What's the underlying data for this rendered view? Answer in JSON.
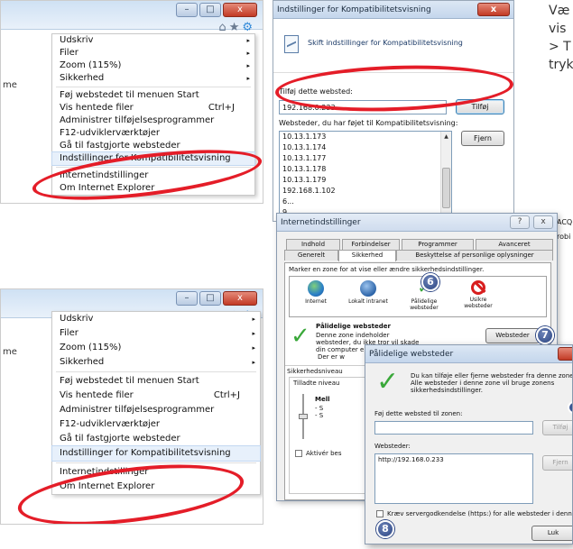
{
  "edge_text": {
    "line1": "Væ",
    "line2": "vis",
    "line3": "> T",
    "line4": "tryk"
  },
  "ie_menu_top": {
    "page_fragment": "me",
    "window_buttons": {
      "minimize": "–",
      "maximize": "□",
      "close": "x"
    },
    "icons": {
      "home": "⌂",
      "favorites": "★",
      "tools": "⚙"
    },
    "items": [
      {
        "label": "Udskriv",
        "arrow": "▸"
      },
      {
        "label": "Filer",
        "arrow": "▸"
      },
      {
        "label": "Zoom (115%)",
        "arrow": "▸"
      },
      {
        "label": "Sikkerhed",
        "arrow": "▸"
      },
      {
        "label": "Føj webstedet til menuen Start"
      },
      {
        "label": "Vis hentede filer",
        "shortcut": "Ctrl+J"
      },
      {
        "label": "Administrer tilføjelsesprogrammer"
      },
      {
        "label": "F12-udviklerværktøjer"
      },
      {
        "label": "Gå til fastgjorte websteder"
      },
      {
        "label": "Indstillinger for Kompatibilitetsvisning"
      },
      {
        "label": "Internetindstillinger"
      },
      {
        "label": "Om Internet Explorer"
      }
    ]
  },
  "ie_menu_bottom": {
    "page_fragment": "me",
    "window_buttons": {
      "minimize": "–",
      "maximize": "□",
      "close": "x"
    },
    "icons": {
      "home": "⌂",
      "favorites": "★",
      "tools": "⚙"
    },
    "items": [
      {
        "label": "Udskriv",
        "arrow": "▸"
      },
      {
        "label": "Filer",
        "arrow": "▸"
      },
      {
        "label": "Zoom (115%)",
        "arrow": "▸"
      },
      {
        "label": "Sikkerhed",
        "arrow": "▸"
      },
      {
        "label": "Føj webstedet til menuen Start"
      },
      {
        "label": "Vis hentede filer",
        "shortcut": "Ctrl+J"
      },
      {
        "label": "Administrer tilføjelsesprogrammer"
      },
      {
        "label": "F12-udviklerværktøjer"
      },
      {
        "label": "Gå til fastgjorte websteder"
      },
      {
        "label": "Indstillinger for Kompatibilitetsvisning"
      },
      {
        "label": "Internetindstillinger"
      },
      {
        "label": "Om Internet Explorer"
      }
    ]
  },
  "compat_dialog": {
    "title": "Indstillinger for Kompatibilitetsvisning",
    "close": "x",
    "header": "Skift indstillinger for Kompatibilitetsvisning",
    "add_label": "Tilføj dette websted:",
    "add_value": "192.168.0.233",
    "add_button": "Tilføj",
    "list_label": "Websteder, du har føjet til Kompatibilitetsvisning:",
    "remove_button": "Fjern",
    "sites": [
      "10.13.1.173",
      "10.13.1.174",
      "10.13.1.177",
      "10.13.1.178",
      "10.13.1.179",
      "192.168.1.102",
      "6...",
      "9..."
    ]
  },
  "internet_options": {
    "title": "Internetindstillinger",
    "help": "?",
    "close": "x",
    "tabs_row1": [
      "Indhold",
      "Forbindelser",
      "Programmer",
      "Avanceret"
    ],
    "tabs_row2": [
      "Generelt",
      "Sikkerhed",
      "Beskyttelse af personlige oplysninger"
    ],
    "instruction": "Marker en zone for at vise eller ændre sikkerhedsindstillinger.",
    "zones": [
      "Internet",
      "Lokalt intranet",
      "Pålidelige websteder",
      "Usikre websteder"
    ],
    "zone_title": "Pålidelige websteder",
    "zone_desc": "Denne zone indeholder websteder, du ikke tror vil skade din computer eller dine filer.",
    "sites_button": "Websteder",
    "partial1": "Der er w",
    "security_level": "Sikkerhedsniveau",
    "allowed_levels": "Tilladte niveau",
    "level_name": "Mell",
    "level_b1": "- S",
    "level_b2": "- S",
    "enable_protected": "Aktivér bes",
    "badge_zone": "6",
    "badge_sites": "7",
    "outside_right1": "ACQ",
    "outside_right2": "robi"
  },
  "trusted_dialog": {
    "title": "Pålidelige websteder",
    "info": "Du kan tilføje eller fjerne websteder fra denne zone. Alle websteder i denne zone vil bruge zonens sikkerhedsindstillinger.",
    "add_label": "Føj dette websted til zonen:",
    "add_button": "Tilføj",
    "sites_label": "Websteder:",
    "sites": [
      "http://192.168.0.233"
    ],
    "remove_button": "Fjern",
    "https_check": "Kræv servergodkendelse (https:) for alle websteder i denne zone",
    "close_button": "Luk",
    "badge": "8"
  }
}
